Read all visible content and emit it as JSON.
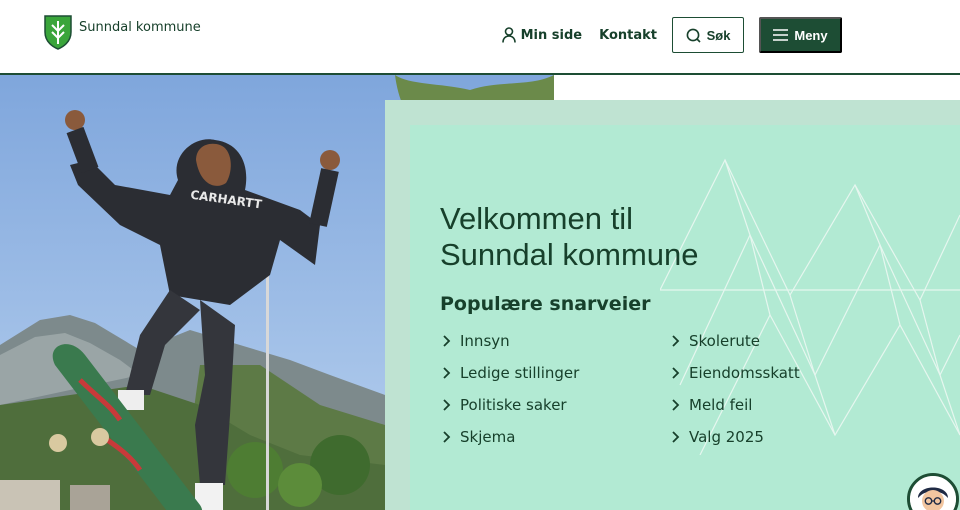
{
  "header": {
    "logo_text": "Sunndal kommune",
    "nav": {
      "min_side": "Min side",
      "kontakt": "Kontakt",
      "search": "Søk",
      "menu": "Meny"
    }
  },
  "hero": {
    "image_subject": "skateboarder-mountain-photo"
  },
  "panel": {
    "title_line1": "Velkommen til",
    "title_line2": "Sunndal kommune",
    "shortcuts_heading": "Populære snarveier",
    "links": [
      "Innsyn",
      "Skolerute",
      "Ledige stillinger",
      "Eiendomsskatt",
      "Politiske saker",
      "Meld feil",
      "Skjema",
      "Valg 2025"
    ]
  },
  "colors": {
    "brand_dark_green": "#1d4d34",
    "panel_mint": "#b2ead3",
    "text_green": "#17402b"
  },
  "icons": [
    "coat-of-arms-icon",
    "user-icon",
    "search-icon",
    "hamburger-icon",
    "chevron-right-icon",
    "chat-avatar-icon"
  ]
}
